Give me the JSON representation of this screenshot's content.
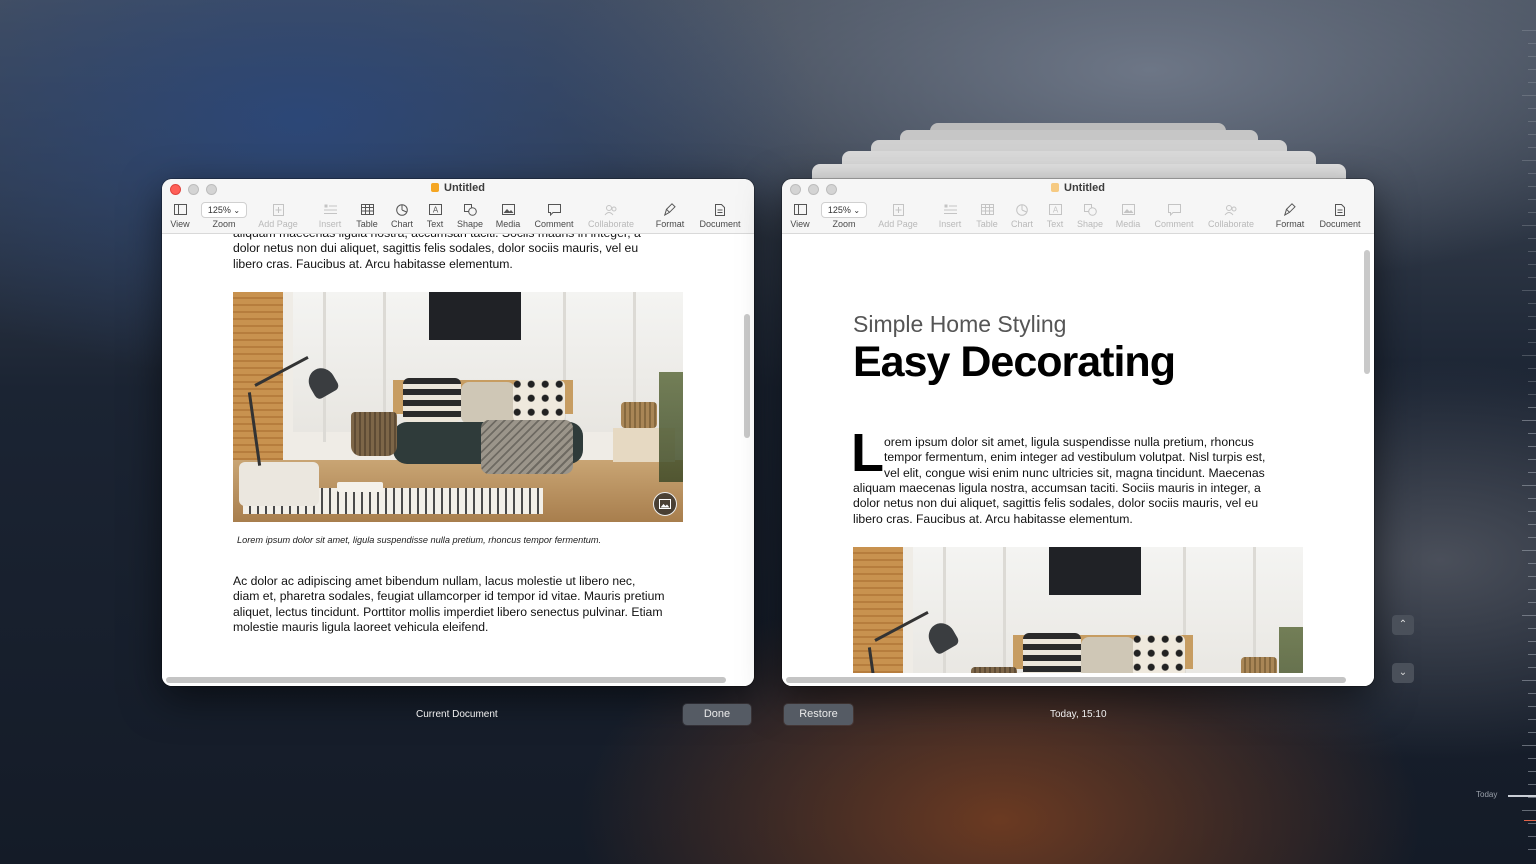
{
  "left_window": {
    "title": "Untitled",
    "zoom_value": "125%",
    "toolbar": [
      {
        "label": "View",
        "icon": "sidebar-icon",
        "enabled": true
      },
      {
        "label": "Zoom",
        "icon": "zoom-menu",
        "enabled": true
      },
      {
        "label": "Add Page",
        "icon": "add-page-icon",
        "enabled": false
      },
      {
        "label": "Insert",
        "icon": "insert-icon",
        "enabled": false
      },
      {
        "label": "Table",
        "icon": "table-icon",
        "enabled": true
      },
      {
        "label": "Chart",
        "icon": "chart-icon",
        "enabled": true
      },
      {
        "label": "Text",
        "icon": "text-icon",
        "enabled": true
      },
      {
        "label": "Shape",
        "icon": "shape-icon",
        "enabled": true
      },
      {
        "label": "Media",
        "icon": "media-icon",
        "enabled": true
      },
      {
        "label": "Comment",
        "icon": "comment-icon",
        "enabled": true
      },
      {
        "label": "Collaborate",
        "icon": "collaborate-icon",
        "enabled": false
      },
      {
        "label": "Format",
        "icon": "format-brush-icon",
        "enabled": true
      },
      {
        "label": "Document",
        "icon": "document-icon",
        "enabled": true
      }
    ],
    "para_top": "aliquam maecenas ligula nostra, accumsan taciti. Sociis mauris in integer, a dolor netus non dui aliquet, sagittis felis sodales, dolor sociis mauris, vel eu libero cras. Faucibus at. Arcu habitasse elementum.",
    "caption": "Lorem ipsum dolor sit amet, ligula suspendisse nulla pretium, rhoncus tempor fermentum.",
    "para_bottom": "Ac dolor ac adipiscing amet bibendum nullam, lacus molestie ut libero nec, diam et, pharetra sodales, feugiat ullamcorper id tempor id vitae. Mauris pretium aliquet, lectus tincidunt. Porttitor mollis imperdiet libero senectus pulvinar. Etiam molestie mauris ligula laoreet vehicula eleifend."
  },
  "right_window": {
    "title": "Untitled",
    "zoom_value": "125%",
    "toolbar": [
      {
        "label": "View",
        "icon": "sidebar-icon",
        "enabled": true
      },
      {
        "label": "Zoom",
        "icon": "zoom-menu",
        "enabled": true
      },
      {
        "label": "Add Page",
        "icon": "add-page-icon",
        "enabled": false
      },
      {
        "label": "Insert",
        "icon": "insert-icon",
        "enabled": false
      },
      {
        "label": "Table",
        "icon": "table-icon",
        "enabled": false
      },
      {
        "label": "Chart",
        "icon": "chart-icon",
        "enabled": false
      },
      {
        "label": "Text",
        "icon": "text-icon",
        "enabled": false
      },
      {
        "label": "Shape",
        "icon": "shape-icon",
        "enabled": false
      },
      {
        "label": "Media",
        "icon": "media-icon",
        "enabled": false
      },
      {
        "label": "Comment",
        "icon": "comment-icon",
        "enabled": false
      },
      {
        "label": "Collaborate",
        "icon": "collaborate-icon",
        "enabled": false
      },
      {
        "label": "Format",
        "icon": "format-brush-icon",
        "enabled": true
      },
      {
        "label": "Document",
        "icon": "document-icon",
        "enabled": true
      }
    ],
    "subtitle": "Simple Home Styling",
    "heading": "Easy Decorating",
    "drop_cap": "L",
    "para_line1": "orem ipsum dolor sit amet, ligula suspendisse nulla pretium, rhoncus",
    "para_line2": "tempor fermentum, enim integer ad vestibulum volutpat. Nisl turpis est,",
    "para_line3": "vel elit, congue wisi enim nunc ultricies sit, magna tincidunt. Maecenas",
    "para_rest": "aliquam maecenas ligula nostra, accumsan taciti. Sociis mauris in integer, a dolor netus non dui aliquet, sagittis felis sodales, dolor sociis mauris, vel eu libero cras. Faucibus at. Arcu habitasse elementum."
  },
  "bottom_bar": {
    "current_label": "Current Document",
    "done_label": "Done",
    "restore_label": "Restore",
    "backup_time": "Today, 15:10",
    "timeline_label": "Today"
  },
  "nav": {
    "up_icon": "chevron-up-icon",
    "down_icon": "chevron-down-icon"
  }
}
